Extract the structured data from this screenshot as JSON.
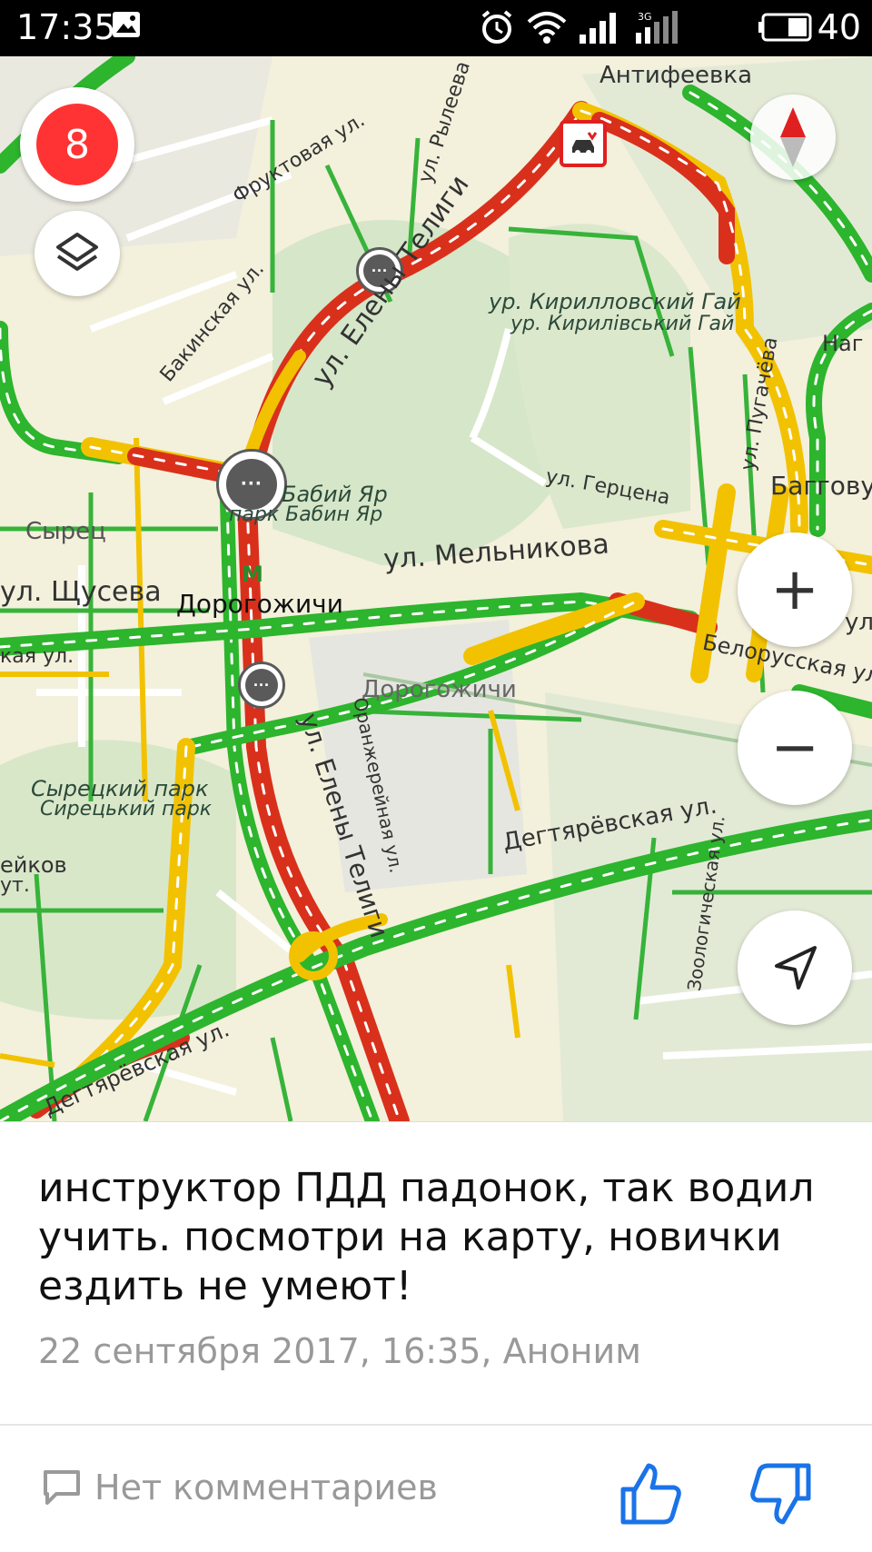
{
  "status_bar": {
    "time": "17:35",
    "network": "3G",
    "battery": "40"
  },
  "map": {
    "traffic_score": "8",
    "labels": {
      "antifeevka": "Антифеевка",
      "fruktovaya": "Фруктовая ул.",
      "ryleeva": "ул. Рылеева",
      "elena_teligi_top": "ул. Елены Телиги",
      "elena_teligi_bottom": "ул. Елены Телиги",
      "bakinskaya": "Бакинская ул.",
      "kirillovsky_ru": "ур. Кирилловский Гай",
      "kirillovsky_ua": "ур. Кирилівський Гай",
      "pugacheva": "ул. Пугачёва",
      "nag": "Наг",
      "babiy_yar_ru": "Бабий Яр",
      "babiy_yar_ua": "парк Бабин Яр",
      "gertsena": "ул. Герцена",
      "baggovut": "Багговут",
      "syrets": "Сырец",
      "shuseva": "ул. Щусева",
      "melnikova": "ул. Мельникова",
      "dorogozhichi_metro": "Дорогожичи",
      "metro_symbol": "M",
      "kaya_ul": "кая ул.",
      "belorusskaya": "Белорусская ул.",
      "dorogozhichi_area": "Дорогожичи",
      "oranzhereynaya": "Оранжерейная ул.",
      "syretsky_park_ru": "Сырецкий парк",
      "syretsky_park_ua": "Сирецький парк",
      "teykov": "ейков",
      "ut": "ут.",
      "degtyarevskaya_right": "Дегтярёвская ул.",
      "degtyarevskaya_left": "Дегтярёвская ул.",
      "zoologicheskaya": "Зоологическая ул.",
      "ul_right": "ул"
    },
    "colors": {
      "free": "#2db52d",
      "medium": "#f2c200",
      "jam": "#d9301c"
    }
  },
  "controls": {
    "layers": "layers-icon",
    "zoom_in": "+",
    "zoom_out": "−",
    "locate": "locate-icon",
    "compass": "compass-icon"
  },
  "post": {
    "message": "инструктор ПДД падонок, так водил учить.  посмотри на карту, новички ездить не умеют!",
    "meta": "22 сентября 2017, 16:35, Аноним",
    "comments": "Нет комментариев"
  }
}
